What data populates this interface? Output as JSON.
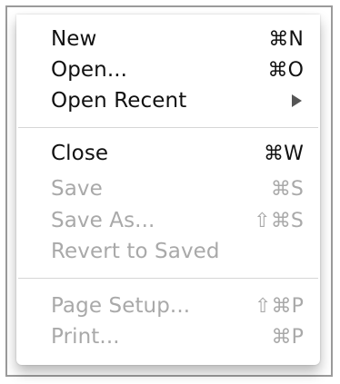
{
  "menu": {
    "items": [
      {
        "label": "New",
        "shortcut": "⌘N",
        "enabled": true
      },
      {
        "label": "Open...",
        "shortcut": "⌘O",
        "enabled": true
      },
      {
        "label": "Open Recent",
        "shortcut": "",
        "enabled": true,
        "submenu": true
      },
      {
        "label": "Close",
        "shortcut": "⌘W",
        "enabled": true
      },
      {
        "label": "Save",
        "shortcut": "⌘S",
        "enabled": false
      },
      {
        "label": "Save As...",
        "shortcut": "⇧⌘S",
        "enabled": false
      },
      {
        "label": "Revert to Saved",
        "shortcut": "",
        "enabled": false
      },
      {
        "label": "Page Setup...",
        "shortcut": "⇧⌘P",
        "enabled": false
      },
      {
        "label": "Print...",
        "shortcut": "⌘P",
        "enabled": false
      }
    ]
  }
}
